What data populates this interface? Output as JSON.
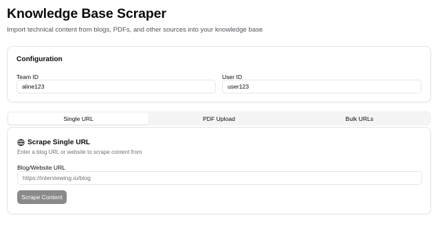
{
  "header": {
    "title": "Knowledge Base Scraper",
    "subtitle": "Import technical content from blogs, PDFs, and other sources into your knowledge base"
  },
  "configuration": {
    "title": "Configuration",
    "team_id": {
      "label": "Team ID",
      "value": "aline123"
    },
    "user_id": {
      "label": "User ID",
      "value": "user123"
    }
  },
  "tabs": [
    {
      "label": "Single URL",
      "active": true
    },
    {
      "label": "PDF Upload",
      "active": false
    },
    {
      "label": "Bulk URLs",
      "active": false
    }
  ],
  "scrape": {
    "icon": "globe-icon",
    "title": "Scrape Single URL",
    "description": "Enter a blog URL or website to scrape content from",
    "url_field": {
      "label": "Blog/Website URL",
      "value": "",
      "placeholder": "https://interviewing.io/blog"
    },
    "button_label": "Scrape Content"
  },
  "colors": {
    "border": "#e4e4e7",
    "tab_bg": "#f4f4f5",
    "muted_text": "#71717a",
    "button_disabled": "#8a8a8a"
  }
}
